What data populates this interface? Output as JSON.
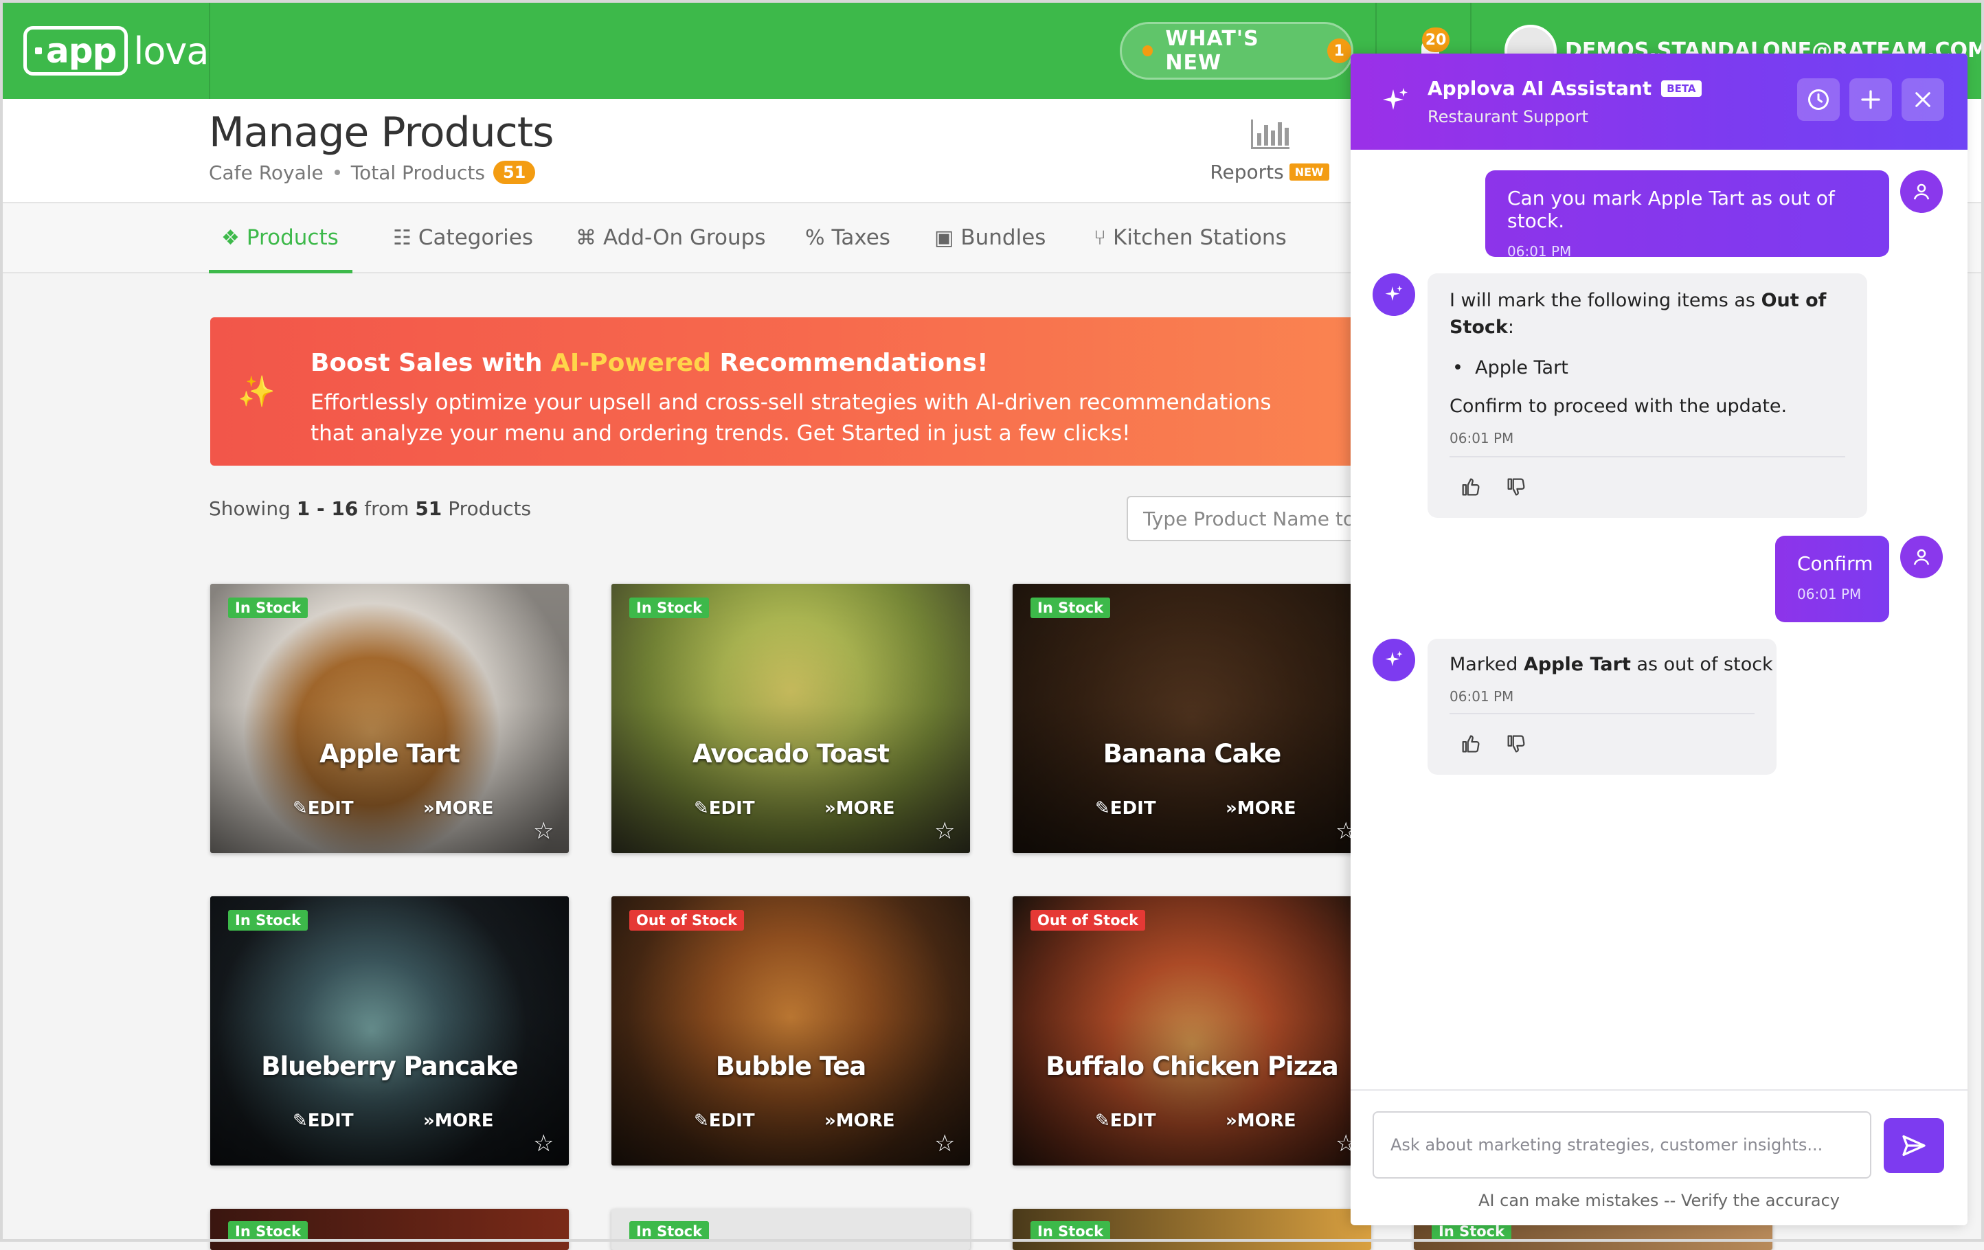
{
  "app": {
    "logo_left": "app",
    "logo_right": "lova",
    "whats_new_label": "WHAT'S NEW",
    "whats_new_count": "1",
    "notifications_count": "20",
    "user_email": "DEMOS.STANDALONE@RATEAM.COM"
  },
  "header": {
    "title": "Manage Products",
    "store_name": "Cafe Royale",
    "total_label": "Total Products",
    "total_count": "51",
    "reports_label": "Reports",
    "reports_badge": "NEW"
  },
  "tabs": [
    {
      "label": "Products",
      "icon": "cubes-icon"
    },
    {
      "label": "Categories",
      "icon": "sitemap-icon"
    },
    {
      "label": "Add-On Groups",
      "icon": "puzzle-icon"
    },
    {
      "label": "Taxes",
      "icon": "percent-icon"
    },
    {
      "label": "Bundles",
      "icon": "box-icon"
    },
    {
      "label": "Kitchen Stations",
      "icon": "utensils-icon"
    }
  ],
  "banner": {
    "head_pre": "Boost Sales with ",
    "head_highlight": "AI-Powered",
    "head_post": " Recommendations!",
    "body": "Effortlessly optimize your upsell and cross-sell strategies with AI-driven recommendations that analyze your menu and ordering trends. Get Started in just a few clicks!"
  },
  "listing": {
    "showing_pre": "Showing",
    "range": "1 - 16",
    "from": "from",
    "total": "51",
    "suffix": "Products",
    "search_placeholder": "Type Product Name to Search"
  },
  "card_actions": {
    "edit": "EDIT",
    "more": "MORE"
  },
  "products": [
    {
      "name": "Apple Tart",
      "stock": "In Stock"
    },
    {
      "name": "Avocado Toast",
      "stock": "In Stock"
    },
    {
      "name": "Banana Cake",
      "stock": "In Stock"
    },
    {
      "name": "Blueberry Pancake",
      "stock": "In Stock"
    },
    {
      "name": "Bubble Tea",
      "stock": "Out of Stock"
    },
    {
      "name": "Buffalo Chicken Pizza",
      "stock": "Out of Stock"
    },
    {
      "name": "",
      "stock": "In Stock"
    },
    {
      "name": "",
      "stock": "In Stock"
    },
    {
      "name": "",
      "stock": "In Stock"
    },
    {
      "name": "",
      "stock": "In Stock"
    }
  ],
  "assistant": {
    "title": "Applova AI Assistant",
    "beta": "BETA",
    "subtitle": "Restaurant Support",
    "messages": [
      {
        "role": "user",
        "text": "Can you mark Apple Tart as out of stock.",
        "time": "06:01 PM"
      },
      {
        "role": "ai",
        "intro": "I will mark the following items as ",
        "intro_bold": "Out of Stock",
        "intro_end": ":",
        "bullet": "Apple Tart",
        "outro": "Confirm to proceed with the update.",
        "time": "06:01 PM"
      },
      {
        "role": "user",
        "text": "Confirm",
        "time": "06:01 PM"
      },
      {
        "role": "ai",
        "pre": "Marked ",
        "bold": "Apple Tart",
        "post": " as out of stock",
        "time": "06:01 PM"
      }
    ],
    "input_placeholder": "Ask about marketing strategies, customer insights...",
    "disclaimer": "AI can make mistakes -- Verify the accuracy"
  }
}
